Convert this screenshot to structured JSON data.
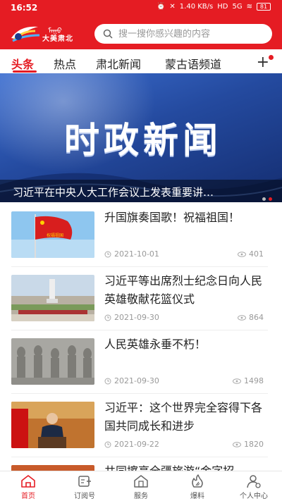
{
  "status": {
    "time": "16:52",
    "speed": "1.40 KB/s",
    "hd": "HD",
    "network": "5G",
    "battery": "81"
  },
  "app": {
    "logo_text": "大美肃北"
  },
  "search": {
    "placeholder": "搜一搜你感兴趣的内容"
  },
  "tabs": [
    {
      "label": "头条",
      "active": true
    },
    {
      "label": "热点"
    },
    {
      "label": "肃北新闻"
    },
    {
      "label": "蒙古语频道"
    }
  ],
  "banner": {
    "title": "时政新闻",
    "caption": "习近平在中央人大工作会议上发表重要讲…",
    "slide_count": 2,
    "active_slide": 2
  },
  "news": [
    {
      "title": "升国旗奏国歌！祝福祖国！",
      "date": "2021-10-01",
      "views": "401",
      "thumb": "flag-image"
    },
    {
      "title": "习近平等出席烈士纪念日向人民英雄敬献花篮仪式",
      "date": "2021-09-30",
      "views": "864",
      "thumb": "monument-image"
    },
    {
      "title": "人民英雄永垂不朽！",
      "date": "2021-09-30",
      "views": "1498",
      "thumb": "relief-image"
    },
    {
      "title": "习近平：这个世界完全容得下各国共同成长和进步",
      "date": "2021-09-22",
      "views": "1820",
      "thumb": "speech-image"
    },
    {
      "title": "共同擦亮全疆旅游“金字招",
      "date": "",
      "views": "",
      "thumb": "partial-image"
    }
  ],
  "bottom_nav": [
    {
      "label": "首页",
      "icon": "home-icon",
      "active": true
    },
    {
      "label": "订阅号",
      "icon": "subscribe-icon"
    },
    {
      "label": "服务",
      "icon": "service-icon"
    },
    {
      "label": "爆料",
      "icon": "report-icon"
    },
    {
      "label": "个人中心",
      "icon": "profile-icon"
    }
  ],
  "colors": {
    "brand": "#e51c23",
    "banner": "#244a9f"
  }
}
